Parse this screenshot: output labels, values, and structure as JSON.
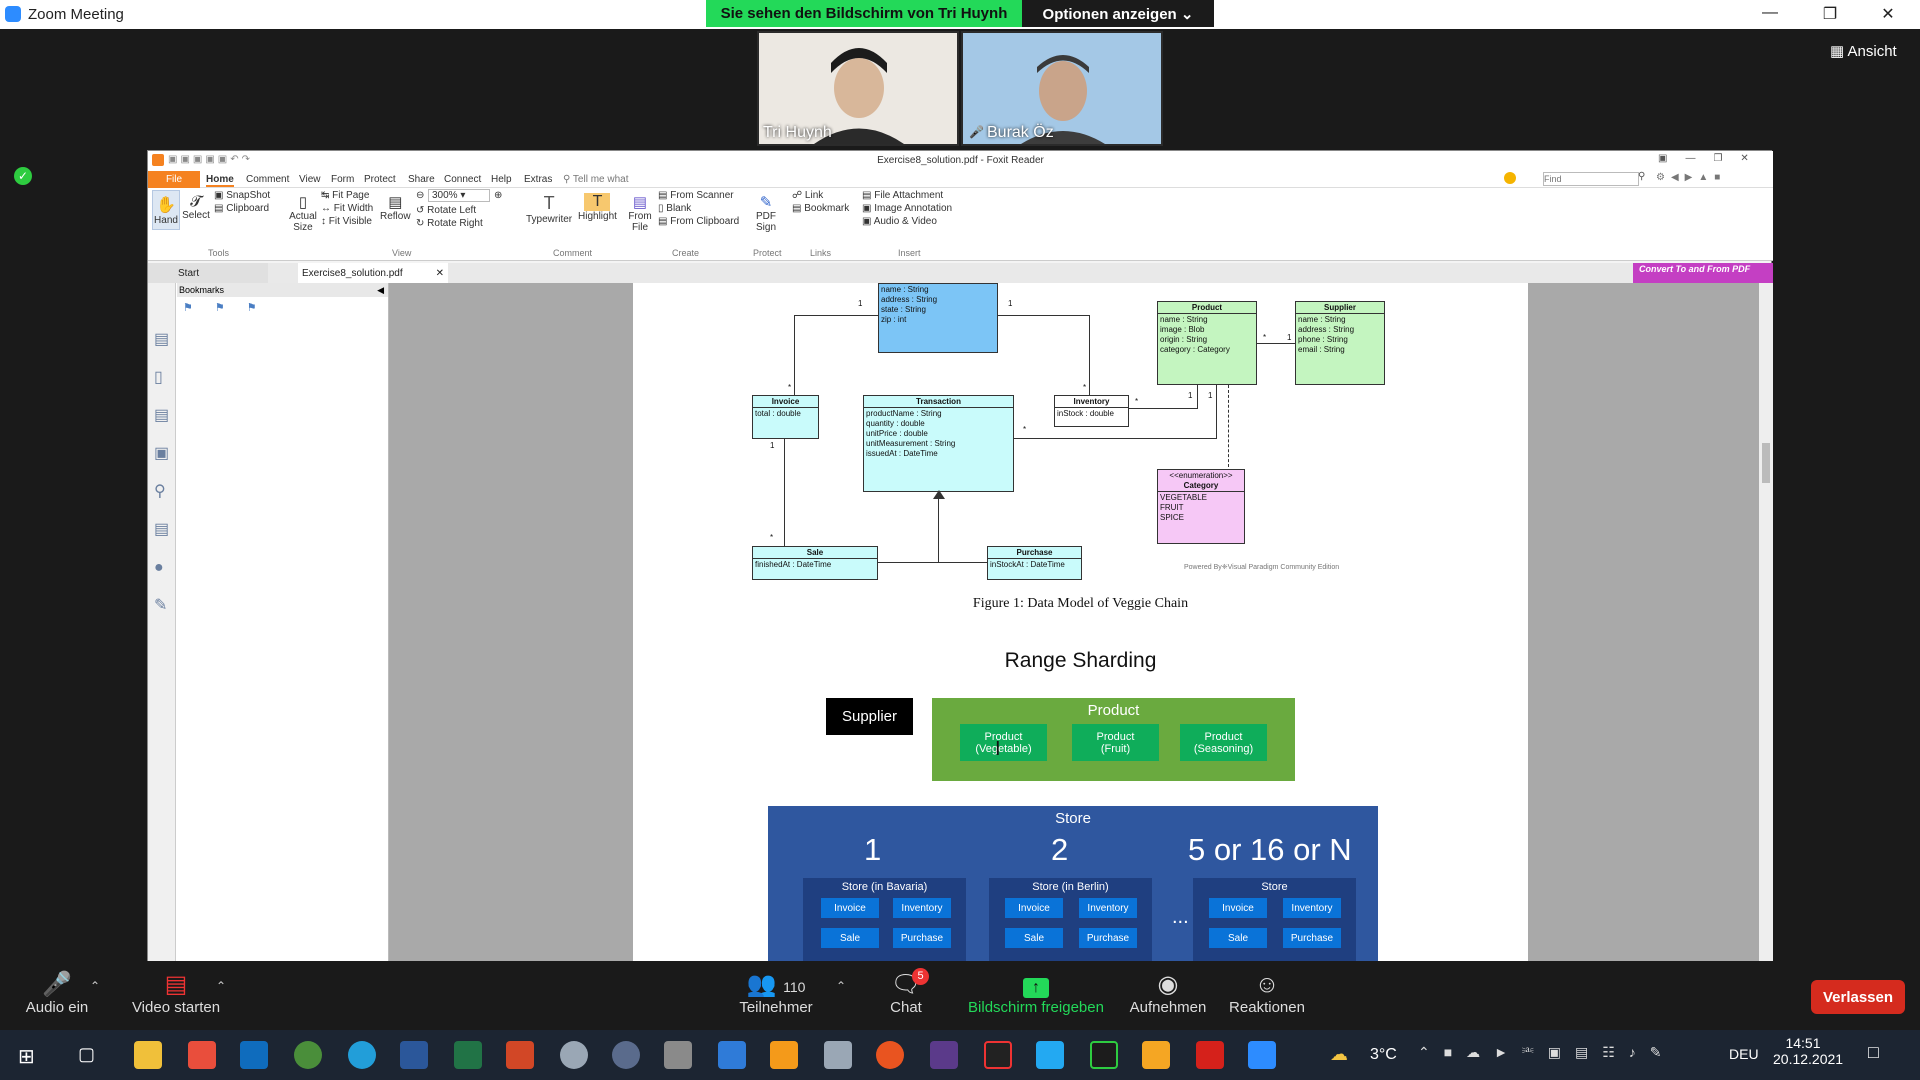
{
  "zoom": {
    "window_title": "Zoom Meeting",
    "share_banner": "Sie sehen den Bildschirm von Tri Huynh",
    "options_button": "Optionen anzeigen ⌄",
    "view_button": "Ansicht",
    "participants": [
      {
        "name": "Tri Huynh"
      },
      {
        "name": "Burak Öz"
      }
    ],
    "toolbar": {
      "audio": "Audio ein",
      "video": "Video starten",
      "participants_label": "Teilnehmer",
      "participants_count": "110",
      "chat": "Chat",
      "chat_badge": "5",
      "share": "Bildschirm freigeben",
      "record": "Aufnehmen",
      "reactions": "Reaktionen",
      "leave": "Verlassen"
    }
  },
  "foxit": {
    "title": "Exercise8_solution.pdf - Foxit Reader",
    "menu": [
      "File",
      "Home",
      "Comment",
      "View",
      "Form",
      "Protect",
      "Share",
      "Connect",
      "Help",
      "Extras"
    ],
    "tell_me": "Tell me what",
    "find_placeholder": "Find",
    "ribbon": {
      "hand": "Hand",
      "select": "Select",
      "snapshot": "SnapShot",
      "clipboard": "Clipboard",
      "actual_size": "Actual Size",
      "fit_page": "Fit Page",
      "fit_width": "Fit Width",
      "fit_visible": "Fit Visible",
      "reflow": "Reflow",
      "zoom": "300%",
      "rotate_left": "Rotate Left",
      "rotate_right": "Rotate Right",
      "typewriter": "Typewriter",
      "highlight": "Highlight",
      "from_file": "From File",
      "from_scanner": "From Scanner",
      "blank": "Blank",
      "from_clipboard": "From Clipboard",
      "pdf_sign": "PDF Sign",
      "link": "Link",
      "bookmark": "Bookmark",
      "file_attachment": "File Attachment",
      "image_annotation": "Image Annotation",
      "audio_video": "Audio & Video",
      "groups": [
        "Tools",
        "View",
        "Comment",
        "Create",
        "Protect",
        "Links",
        "Insert"
      ]
    },
    "convert_banner": "Convert To and From PDF",
    "tabs": [
      "Start",
      "Exercise8_solution.pdf"
    ],
    "bookmarks_label": "Bookmarks"
  },
  "pdf": {
    "uml": {
      "address_attrs": [
        "name : String",
        "address : String",
        "state : String",
        "zip : int"
      ],
      "product": {
        "title": "Product",
        "attrs": [
          "name : String",
          "image : Blob",
          "origin : String",
          "category : Category"
        ]
      },
      "supplier": {
        "title": "Supplier",
        "attrs": [
          "name : String",
          "address : String",
          "phone : String",
          "email : String"
        ]
      },
      "invoice": {
        "title": "Invoice",
        "attrs": [
          "total : double"
        ]
      },
      "transaction": {
        "title": "Transaction",
        "attrs": [
          "productName : String",
          "quantity : double",
          "unitPrice : double",
          "unitMeasurement : String",
          "issuedAt : DateTime"
        ]
      },
      "inventory": {
        "title": "Inventory",
        "attrs": [
          "inStock : double"
        ]
      },
      "category": {
        "stereotype": "<<enumeration>>",
        "title": "Category",
        "values": [
          "VEGETABLE",
          "FRUIT",
          "SPICE"
        ]
      },
      "sale": {
        "title": "Sale",
        "attrs": [
          "finishedAt : DateTime"
        ]
      },
      "purchase": {
        "title": "Purchase",
        "attrs": [
          "inStockAt : DateTime"
        ]
      },
      "mult_1": "1",
      "mult_star": "*",
      "powered_by": "Powered By❈Visual Paradigm Community Edition"
    },
    "figure_caption": "Figure 1: Data Model of Veggie Chain",
    "sharding": {
      "title": "Range Sharding",
      "supplier": "Supplier",
      "product": "Product",
      "product_shards": [
        "Product\n(Vegetable)",
        "Product\n(Fruit)",
        "Product\n(Seasoning)"
      ],
      "store": "Store",
      "store_ids": [
        "1",
        "2",
        "5 or 16 or N"
      ],
      "store_boxes": [
        "Store (in Bavaria)",
        "Store (in Berlin)",
        "Store"
      ],
      "store_items": [
        "Invoice",
        "Inventory",
        "Sale",
        "Purchase"
      ],
      "ellipsis": "..."
    }
  },
  "taskbar": {
    "weather": "3°C",
    "lang": "DEU",
    "time": "14:51",
    "date": "20.12.2021"
  }
}
